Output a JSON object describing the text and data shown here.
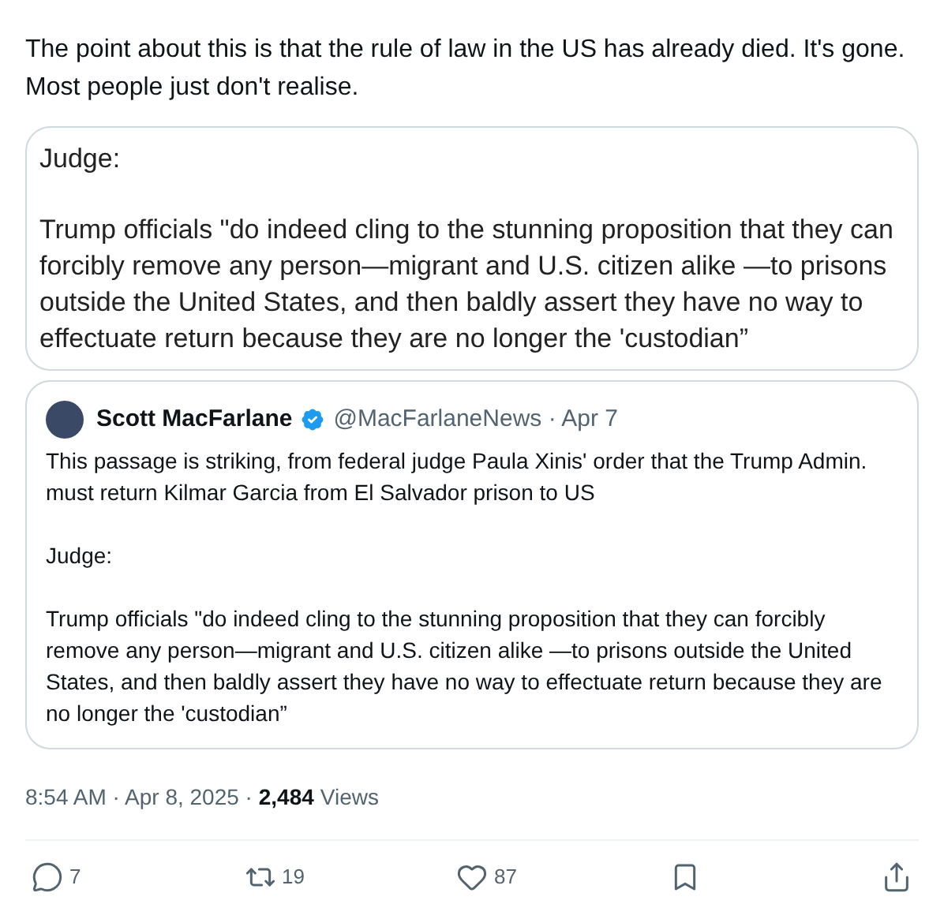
{
  "tweet": {
    "text": "The point about this is that the rule of law in the US has already died. It's gone. Most people just don't realise."
  },
  "image_card": {
    "lines": [
      "Judge:",
      "Trump officials \"do indeed cling  to the stunning proposition that they can forcibly remove any person—migrant and U.S. citizen alike —to prisons outside the United States, and then baldly assert they have no way to effectuate  return because they are no longer the 'custodian”"
    ]
  },
  "quote": {
    "name": "Scott MacFarlane",
    "verified": true,
    "handle": "@MacFarlaneNews · Apr 7",
    "paragraphs": [
      "This passage is striking, from federal judge Paula Xinis' order that the Trump Admin. must return Kilmar Garcia from El Salvador prison to US",
      "Judge:",
      "Trump officials \"do indeed cling  to the stunning proposition that they can forcibly remove any person—migrant and U.S. citizen alike —to prisons outside the United States, and then baldly assert they have no way to effectuate  return because they are no longer the 'custodian”"
    ]
  },
  "meta": {
    "time": "8:54 AM · Apr 8, 2025 · ",
    "views_count": "2,484",
    "views_label": "Views"
  },
  "actions": [
    {
      "kind": "reply",
      "count": "7"
    },
    {
      "kind": "repost",
      "count": "19"
    },
    {
      "kind": "like",
      "count": "87"
    },
    {
      "kind": "bookmark"
    },
    {
      "kind": "share"
    }
  ]
}
